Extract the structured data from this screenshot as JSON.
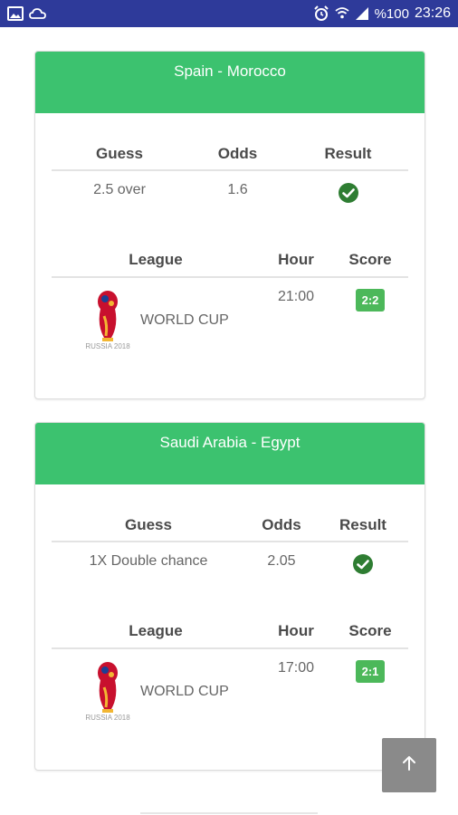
{
  "status_bar": {
    "battery": "%100",
    "time": "23:26",
    "bg_color": "#2E3A9A",
    "icons_left": [
      "image-icon",
      "cloud-icon"
    ],
    "icons_right": [
      "alarm-icon",
      "wifi-icon",
      "signal-icon"
    ]
  },
  "colors": {
    "header_green": "#3CC26F",
    "score_green": "#4CB85A",
    "check_green": "#2E7D32"
  },
  "headers": {
    "guess": "Guess",
    "odds": "Odds",
    "result": "Result",
    "league": "League",
    "hour": "Hour",
    "score": "Score"
  },
  "matches": [
    {
      "title": "Spain - Morocco",
      "guess": "2.5 over",
      "odds": "1.6",
      "result_icon": "check-circle-icon",
      "league": "WORLD CUP",
      "hour": "21:00",
      "score": "2:2"
    },
    {
      "title": "Saudi Arabia - Egypt",
      "guess": "1X Double chance",
      "odds": "2.05",
      "result_icon": "check-circle-icon",
      "league": "WORLD CUP",
      "hour": "17:00",
      "score": "2:1"
    }
  ],
  "logo_text": "RUSSIA 2018",
  "scroll_top_icon": "arrow-up-icon"
}
